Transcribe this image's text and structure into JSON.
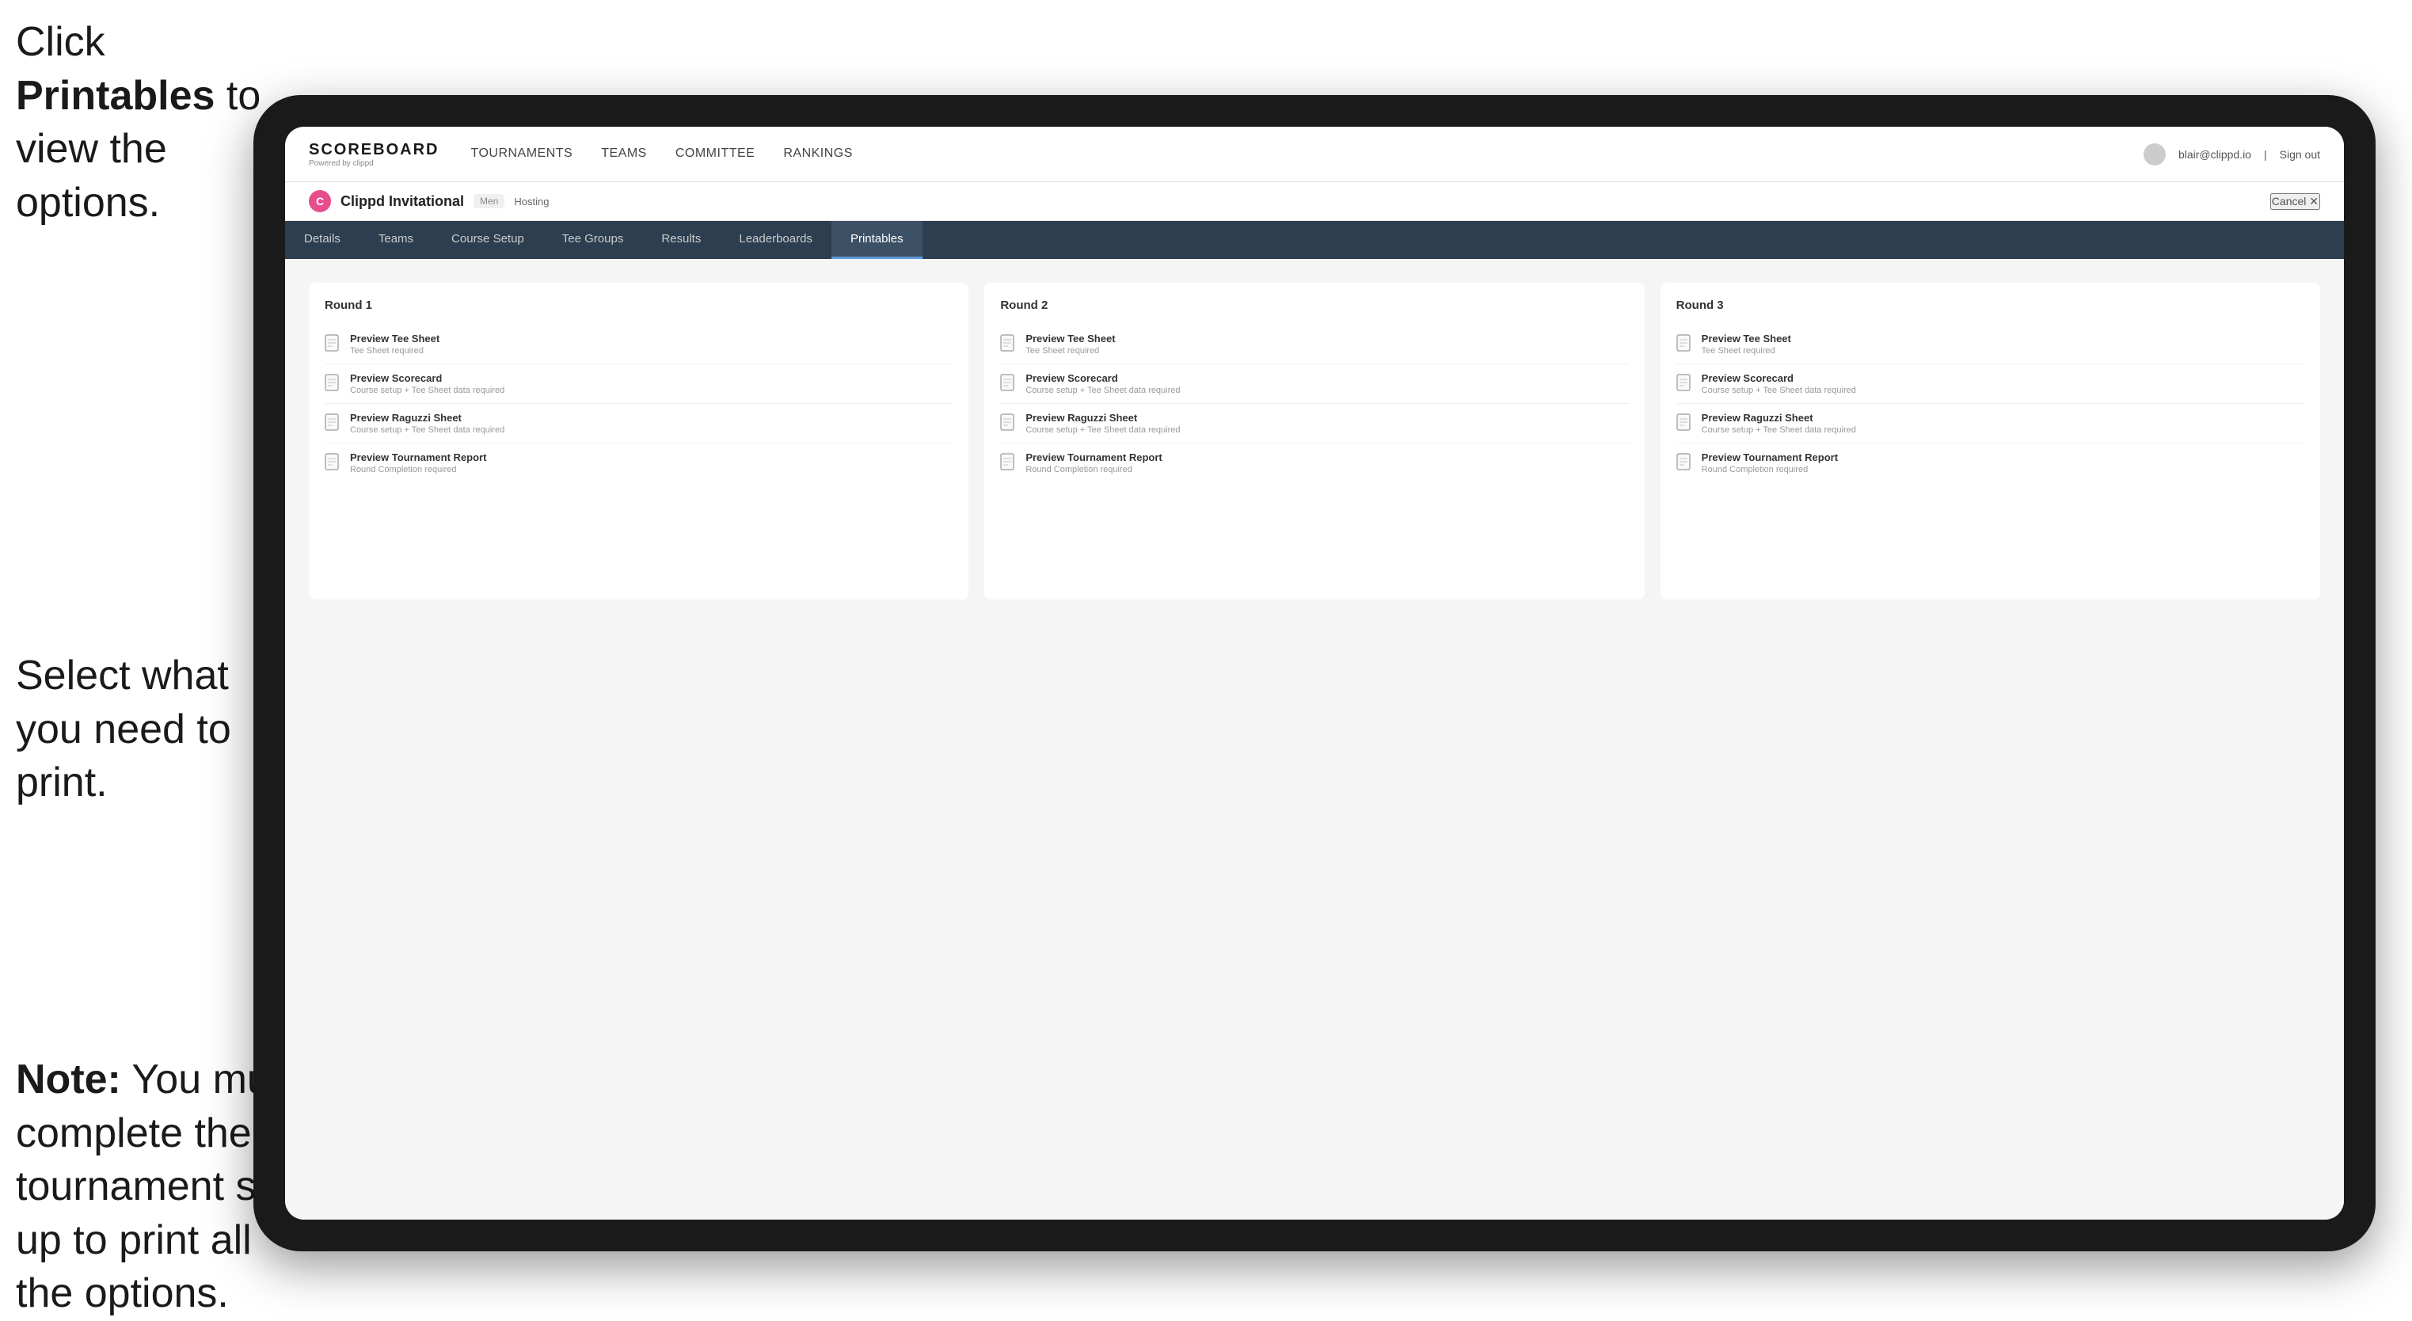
{
  "annotations": {
    "top": {
      "prefix": "Click ",
      "bold": "Printables",
      "suffix": " to view the options."
    },
    "middle": {
      "text": "Select what you need to print."
    },
    "bottom": {
      "bold": "Note:",
      "text": " You must complete the tournament set-up to print all the options."
    }
  },
  "nav": {
    "brand": "SCOREBOARD",
    "brand_sub": "Powered by clippd",
    "links": [
      {
        "label": "TOURNAMENTS",
        "active": false
      },
      {
        "label": "TEAMS",
        "active": false
      },
      {
        "label": "COMMITTEE",
        "active": false
      },
      {
        "label": "RANKINGS",
        "active": false
      }
    ],
    "user_email": "blair@clippd.io",
    "sign_out": "Sign out"
  },
  "tournament": {
    "logo_letter": "C",
    "name": "Clippd Invitational",
    "gender": "Men",
    "status": "Hosting",
    "cancel_label": "Cancel ✕"
  },
  "tabs": [
    {
      "label": "Details",
      "active": false
    },
    {
      "label": "Teams",
      "active": false
    },
    {
      "label": "Course Setup",
      "active": false
    },
    {
      "label": "Tee Groups",
      "active": false
    },
    {
      "label": "Results",
      "active": false
    },
    {
      "label": "Leaderboards",
      "active": false
    },
    {
      "label": "Printables",
      "active": true
    }
  ],
  "rounds": [
    {
      "title": "Round 1",
      "items": [
        {
          "title": "Preview Tee Sheet",
          "subtitle": "Tee Sheet required"
        },
        {
          "title": "Preview Scorecard",
          "subtitle": "Course setup + Tee Sheet data required"
        },
        {
          "title": "Preview Raguzzi Sheet",
          "subtitle": "Course setup + Tee Sheet data required"
        },
        {
          "title": "Preview Tournament Report",
          "subtitle": "Round Completion required"
        }
      ]
    },
    {
      "title": "Round 2",
      "items": [
        {
          "title": "Preview Tee Sheet",
          "subtitle": "Tee Sheet required"
        },
        {
          "title": "Preview Scorecard",
          "subtitle": "Course setup + Tee Sheet data required"
        },
        {
          "title": "Preview Raguzzi Sheet",
          "subtitle": "Course setup + Tee Sheet data required"
        },
        {
          "title": "Preview Tournament Report",
          "subtitle": "Round Completion required"
        }
      ]
    },
    {
      "title": "Round 3",
      "items": [
        {
          "title": "Preview Tee Sheet",
          "subtitle": "Tee Sheet required"
        },
        {
          "title": "Preview Scorecard",
          "subtitle": "Course setup + Tee Sheet data required"
        },
        {
          "title": "Preview Raguzzi Sheet",
          "subtitle": "Course setup + Tee Sheet data required"
        },
        {
          "title": "Preview Tournament Report",
          "subtitle": "Round Completion required"
        }
      ]
    }
  ]
}
